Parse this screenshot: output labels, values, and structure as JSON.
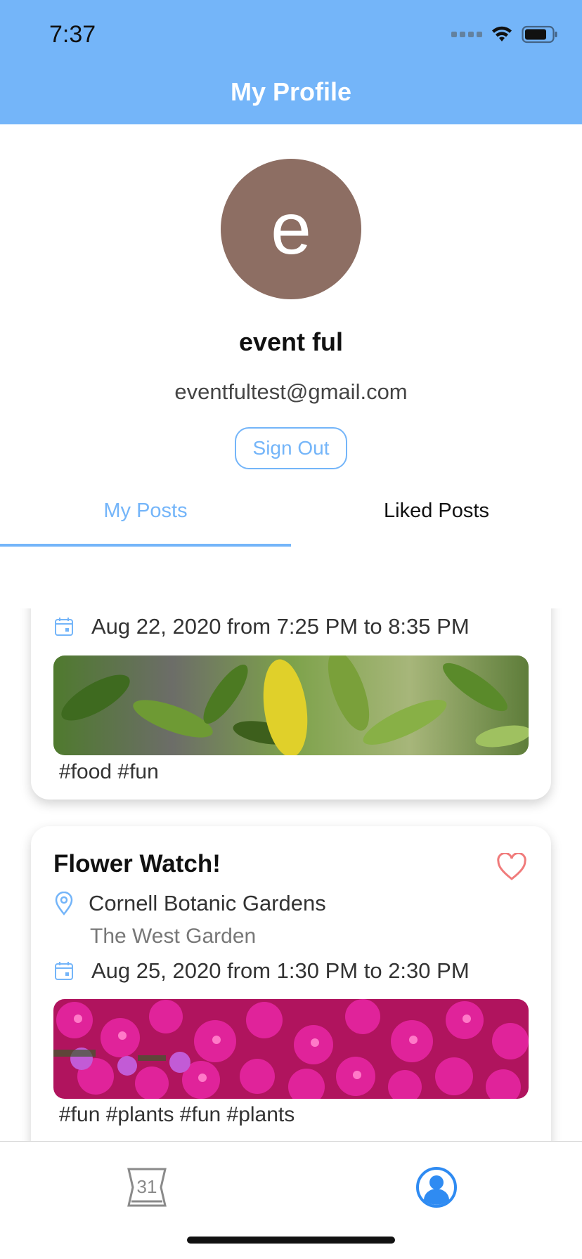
{
  "status_bar": {
    "time": "7:37"
  },
  "nav": {
    "title": "My Profile"
  },
  "profile": {
    "avatar_initial": "e",
    "name": "event ful",
    "email": "eventfultest@gmail.com",
    "sign_out_label": "Sign Out"
  },
  "tabs": [
    {
      "label": "My Posts",
      "active": true
    },
    {
      "label": "Liked Posts",
      "active": false
    }
  ],
  "posts": [
    {
      "date": "Aug 22, 2020 from 7:25 PM to 8:35 PM",
      "image": "green-leaves-photo",
      "tags": "#food #fun"
    },
    {
      "title": "Flower Watch!",
      "location": "Cornell Botanic Gardens",
      "sublocation": "The West Garden",
      "date": "Aug 25, 2020 from 1:30 PM to 2:30 PM",
      "image": "pink-flowers-photo",
      "tags": "#fun #plants #fun #plants"
    }
  ],
  "tabbar": {
    "calendar_day": "31",
    "items": [
      "calendar-icon",
      "profile-icon"
    ]
  },
  "colors": {
    "accent": "#74b5f9",
    "avatar_bg": "#8d6e63",
    "heart": "#f07b7b"
  }
}
